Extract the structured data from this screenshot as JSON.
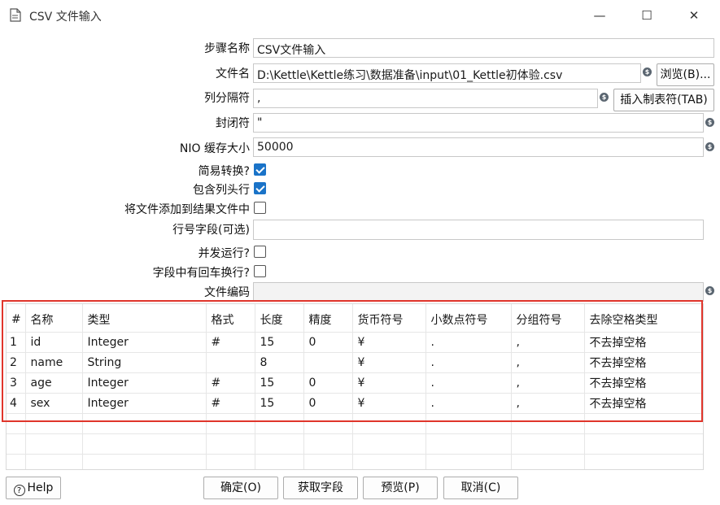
{
  "window": {
    "title": "CSV 文件输入",
    "min_glyph": "—",
    "max_glyph": "☐",
    "close_glyph": "✕"
  },
  "form": {
    "step_name": {
      "label": "步骤名称",
      "value": "CSV文件输入"
    },
    "file_name": {
      "label": "文件名",
      "value": "D:\\Kettle\\Kettle练习\\数据准备\\input\\01_Kettle初体验.csv",
      "browse_button": "浏览(B)..."
    },
    "delimiter": {
      "label": "列分隔符",
      "value": ",",
      "insert_tab_button": "插入制表符(TAB)"
    },
    "enclosure": {
      "label": "封闭符",
      "value": "\""
    },
    "nio_buffer": {
      "label": "NIO 缓存大小",
      "value": "50000"
    },
    "lazy_conversion": {
      "label": "简易转换?",
      "checked": true
    },
    "header_row": {
      "label": "包含列头行",
      "checked": true
    },
    "add_to_result": {
      "label": "将文件添加到结果文件中",
      "checked": false
    },
    "rownum_field": {
      "label": "行号字段(可选)",
      "value": ""
    },
    "parallel": {
      "label": "并发运行?",
      "checked": false
    },
    "newline_in_field": {
      "label": "字段中有回车换行?",
      "checked": false
    },
    "encoding": {
      "label": "文件编码",
      "value": ""
    }
  },
  "variable_icon": "$",
  "fields_table": {
    "headers": [
      "#",
      "名称",
      "类型",
      "格式",
      "长度",
      "精度",
      "货币符号",
      "小数点符号",
      "分组符号",
      "去除空格类型"
    ],
    "rows": [
      [
        "1",
        "id",
        "Integer",
        "#",
        "15",
        "0",
        "¥",
        ".",
        ",",
        "不去掉空格"
      ],
      [
        "2",
        "name",
        "String",
        "",
        "8",
        "",
        "¥",
        ".",
        ",",
        "不去掉空格"
      ],
      [
        "3",
        "age",
        "Integer",
        "#",
        "15",
        "0",
        "¥",
        ".",
        ",",
        "不去掉空格"
      ],
      [
        "4",
        "sex",
        "Integer",
        "#",
        "15",
        "0",
        "¥",
        ".",
        ",",
        "不去掉空格"
      ]
    ]
  },
  "buttons": {
    "help": "Help",
    "ok": "确定(O)",
    "get_fields": "获取字段",
    "preview": "预览(P)",
    "cancel": "取消(C)"
  },
  "colors": {
    "highlight_box": "#e0352b",
    "checkbox_checked": "#1a73c8"
  }
}
